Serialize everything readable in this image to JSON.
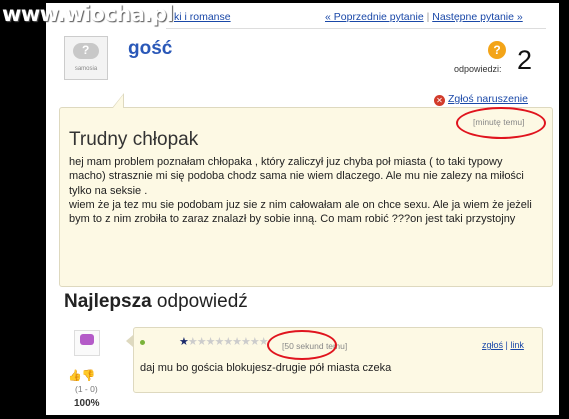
{
  "watermark": "www.wiocha.pl",
  "topbar": {
    "breadcrumb": "ki i romanse",
    "prev_label": "« Poprzednie pytanie",
    "separator": "|",
    "next_label": "Następne pytanie »"
  },
  "question": {
    "avatar_label": "samosia",
    "user": "gość",
    "answers_label": "odpowiedzi:",
    "answers_count": "2",
    "report_label": "Zgłoś naruszenie",
    "time": "[minutę temu]",
    "title": "Trudny chłopak",
    "body": "hej mam problem poznałam chłopaka , który zaliczył juz chyba poł miasta ( to taki typowy macho) strasznie mi się podoba chodz sama nie wiem dlaczego. Ale mu nie zalezy na miłości tylko na seksie .\nwiem że ja tez mu sie podobam juz sie z nim całowałam ale on chce sexu. Ale ja wiem że jeżeli bym to z nim zrobiła to zaraz znalazł by sobie inną. Co mam robić ???on jest taki przystojny"
  },
  "best_answer": {
    "heading_bold": "Najlepsza",
    "heading_rest": " odpowiedź",
    "votes": "(1 - 0)",
    "percent": "100%",
    "stars": "★★★★★★★★★★",
    "time": "[50 sekund temu]",
    "report_link": "zgłoś",
    "link_label": "link",
    "link_sep": "|",
    "body": "daj mu bo gościa blokujesz-drugie pół miasta czeka"
  },
  "colors": {
    "link": "#1a48a8",
    "highlight_circle": "#e0141e",
    "box_bg": "#fdf9e4",
    "answers_icon": "#f3a418"
  }
}
